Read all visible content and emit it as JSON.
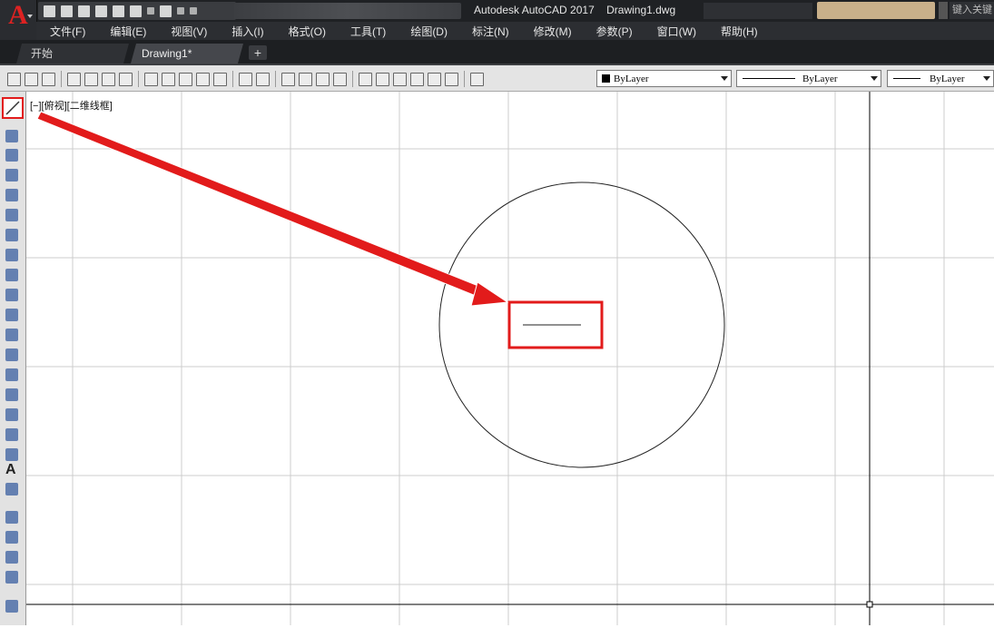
{
  "app": {
    "title": "Autodesk AutoCAD 2017",
    "file": "Drawing1.dwg",
    "logo": "A",
    "search_placeholder": "键入关键"
  },
  "menu": [
    "文件(F)",
    "编辑(E)",
    "视图(V)",
    "插入(I)",
    "格式(O)",
    "工具(T)",
    "绘图(D)",
    "标注(N)",
    "修改(M)",
    "参数(P)",
    "窗口(W)",
    "帮助(H)"
  ],
  "tabs": {
    "start": "开始",
    "drawing": "Drawing1*",
    "add": "+"
  },
  "toolbar": {
    "color": "ByLayer",
    "linetype": "ByLayer",
    "lineweight": "ByLayer"
  },
  "viewport": {
    "label": "[−][俯视][二维线框]"
  },
  "colors": {
    "highlight": "#e21b1b",
    "titlebar": "#1f2124",
    "grid": "#c8c8c8"
  }
}
